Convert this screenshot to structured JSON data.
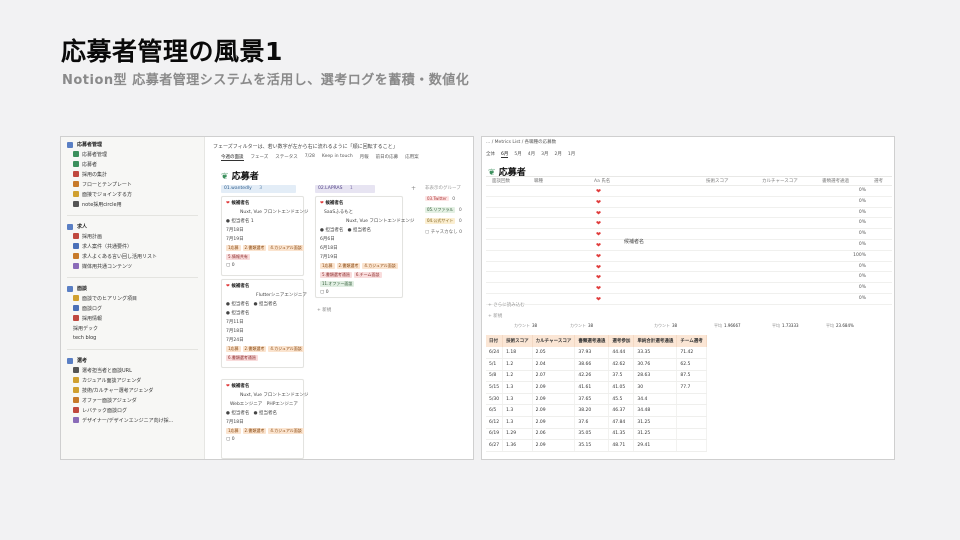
{
  "slide": {
    "title": "応募者管理の風景1",
    "subtitle": "Notion型 応募者管理システムを活用し、選考ログを蓄積・数値化"
  },
  "left": {
    "sidebar": [
      {
        "header": "応募者管理",
        "items": [
          {
            "label": "応募者管理",
            "icon_color": "#3b8f5c",
            "sub": false
          },
          {
            "label": "応募者",
            "icon_color": "#3b8f5c",
            "sub": false
          },
          {
            "label": "採用の集計",
            "icon_color": "#c0483f",
            "sub": false
          },
          {
            "label": "フローとテンプレート",
            "icon_color": "#c77a2a",
            "sub": false
          },
          {
            "label": "面接でジョインする方",
            "icon_color": "#d0a030",
            "sub": false
          },
          {
            "label": "note採用circle用",
            "icon_color": "#555555",
            "sub": false
          }
        ]
      },
      {
        "header": "求人",
        "items": [
          {
            "label": "採用計画",
            "icon_color": "#c0483f",
            "sub": false
          },
          {
            "label": "求人案件（共通要件）",
            "icon_color": "#4a70b8",
            "sub": false
          },
          {
            "label": "求人よくある言い回し活用リスト",
            "icon_color": "#c77a2a",
            "sub": false
          },
          {
            "label": "媒体用共通コンテンツ",
            "icon_color": "#8a6bb8",
            "sub": false
          }
        ]
      },
      {
        "header": "面談",
        "items": [
          {
            "label": "面談でのヒアリング項目",
            "icon_color": "#d0a030",
            "sub": false
          },
          {
            "label": "面談ログ",
            "icon_color": "#4a70b8",
            "sub": false
          },
          {
            "label": "採用情報",
            "icon_color": "#c0483f",
            "sub": false
          },
          {
            "label": "採用デック",
            "icon_color": "",
            "sub": false
          },
          {
            "label": "tech blog",
            "icon_color": "",
            "sub": false
          }
        ]
      },
      {
        "header": "選考",
        "items": [
          {
            "label": "選考担当者と面談URL",
            "icon_color": "#555555",
            "sub": false
          },
          {
            "label": "カジュアル面談アジェンダ",
            "icon_color": "#d0a030",
            "sub": false
          },
          {
            "label": "技術/カルチャー選考アジェンダ",
            "icon_color": "#d0a030",
            "sub": false
          },
          {
            "label": "オファー面談アジェンダ",
            "icon_color": "#c77a2a",
            "sub": false
          },
          {
            "label": "レバテック面談ログ",
            "icon_color": "#c0483f",
            "sub": false
          },
          {
            "label": "デザイナー/デザインエンジニア向け採...",
            "icon_color": "#8a6bb8",
            "sub": false
          }
        ]
      }
    ],
    "board_note": "フェーズフィルターは、若い数字が左から右に流れるように「順に回転すること」",
    "tabs": [
      "今週の面談",
      "フェーズ",
      "ステータス",
      "7/28",
      "Keep in touch",
      "月報",
      "前日の応募",
      "応用案"
    ],
    "board_title": "応募者",
    "columns": [
      {
        "label": "01.wantedly",
        "count": "3"
      },
      {
        "label": "02.LAPRAS",
        "count": "1"
      }
    ],
    "cards_col1": [
      {
        "name": "候補者名",
        "role": "Nuxt, Vue フロントエンドエンジ",
        "assignee": "担当者名",
        "count": "1",
        "dates": [
          "7月18日",
          "7月19日"
        ],
        "tags": [
          "1応募",
          "2.書類選考",
          "4.カジュアル面談",
          "5.情報共有"
        ],
        "comments": "0"
      },
      {
        "name": "候補者名",
        "role": "Flutterシニアエンジニア",
        "assignee": "担当者名",
        "assignee2": "担当者名",
        "assignee3": "担当者名",
        "dates": [
          "7月11日",
          "7月18日",
          "7月24日"
        ],
        "tags": [
          "1応募",
          "2.書類選考",
          "4.カジュアル面談",
          "6.書類選考通過"
        ],
        "comments": "0"
      },
      {
        "name": "候補者名",
        "role": "Nuxt, Vue フロントエンドエンジ",
        "role2": "Webエンジニア",
        "role3": "PHPエンジニア",
        "assignee": "担当者名",
        "assignee2": "担当者名",
        "dates": [
          "7月18日"
        ],
        "tags": [
          "1応募",
          "2.書類選考",
          "4.カジュアル面談"
        ],
        "comments": "0"
      }
    ],
    "cards_col2": [
      {
        "name": "候補者名",
        "role": "SaaSふるもと",
        "role2": "Nuxt, Vue フロントエンドエンジ",
        "assignee": "担当者名",
        "assignee2": "担当者名",
        "dates": [
          "6月6日",
          "6月18日",
          "7月19日"
        ],
        "tags": [
          "1応募",
          "2.書類選考",
          "4.カジュアル面談",
          "5.書類選考通過",
          "6.チーム面談",
          "11.オファー面談"
        ],
        "comments": "0"
      }
    ],
    "new_label": "+ 新規",
    "hidden_groups_label": "非表示のグループ",
    "hidden_groups": [
      {
        "label": "03.Twitter",
        "count": "0"
      },
      {
        "label": "05.リファラル",
        "count": "0"
      },
      {
        "label": "04.公式サイト",
        "count": "0"
      },
      {
        "label": "チャスカなし",
        "count": "0"
      }
    ]
  },
  "right": {
    "breadcrumb": "... / Metrics List / 各職種の応募数",
    "tabs": [
      "全体",
      "6月",
      "5月",
      "4月",
      "3月",
      "2月",
      "1月"
    ],
    "title": "応募者",
    "grid_headers": [
      "面談回数",
      "職種",
      "Aa 氏名",
      "技術スコア",
      "カルチャースコア",
      "書類選考通過",
      "選考"
    ],
    "merged_name": "候補者名",
    "pct_values": [
      "0%",
      "0%",
      "0%",
      "0%",
      "0%",
      "0%",
      "100%",
      "0%",
      "0%",
      "0%",
      "0%"
    ],
    "hidden_rows_label": "+ さらに読み込む",
    "new_label": "+ 新規",
    "stats": [
      {
        "label": "カウント",
        "value": "38"
      },
      {
        "label": "カウント",
        "value": "38"
      },
      {
        "label": "カウント",
        "value": "38"
      },
      {
        "label": "平均",
        "value": "1.96667"
      },
      {
        "label": "平均",
        "value": "1.73333"
      },
      {
        "label": "平均",
        "value": "23.684%"
      }
    ],
    "metrics_headers": [
      "日付",
      "技術スコア",
      "カルチャースコア",
      "書類選考通過",
      "選考参加",
      "単純合計選考通過",
      "チーム選考"
    ],
    "metrics_rows": [
      [
        "6/24",
        "1.18",
        "2.05",
        "37.93",
        "44.44",
        "33.35",
        "71.42"
      ],
      [
        "5/1",
        "1.2",
        "2.04",
        "38.66",
        "42.62",
        "30.76",
        "62.5"
      ],
      [
        "5/8",
        "1.2",
        "2.07",
        "42.26",
        "37.5",
        "28.63",
        "87.5"
      ],
      [
        "5/15",
        "1.3",
        "2.09",
        "41.61",
        "41.05",
        "30",
        "77.7"
      ],
      [
        "5/30",
        "1.3",
        "2.09",
        "37.65",
        "45.5",
        "34.4",
        ""
      ],
      [
        "6/5",
        "1.3",
        "2.09",
        "38.20",
        "46.37",
        "34.48",
        ""
      ],
      [
        "6/12",
        "1.3",
        "2.09",
        "37.6",
        "47.84",
        "31.25",
        ""
      ],
      [
        "6/19",
        "1.29",
        "2.06",
        "35.05",
        "41.35",
        "31.25",
        ""
      ],
      [
        "6/27",
        "1.36",
        "2.09",
        "35.15",
        "48.71",
        "29.41",
        ""
      ]
    ]
  }
}
